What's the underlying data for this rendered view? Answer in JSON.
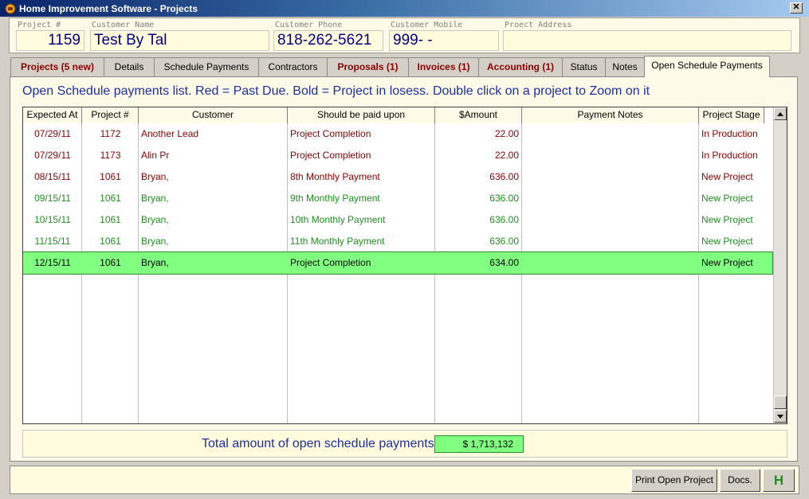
{
  "window": {
    "title": "Home Improvement Software - Projects",
    "close_label": "✕"
  },
  "header": {
    "project_no": {
      "label": "Project #",
      "value": "1159"
    },
    "customer_name": {
      "label": "Customer Name",
      "value": "Test By Tal"
    },
    "customer_phone": {
      "label": "Customer Phone",
      "value": "818-262-5621"
    },
    "customer_mobile": {
      "label": "Customer Mobile",
      "value": "999-  -"
    },
    "project_address": {
      "label": "Proect Address",
      "value": ""
    }
  },
  "tabs": [
    {
      "label": "Projects (5 new)",
      "style": "red"
    },
    {
      "label": "Details",
      "style": "normal"
    },
    {
      "label": "Schedule Payments",
      "style": "normal"
    },
    {
      "label": "Contractors",
      "style": "normal"
    },
    {
      "label": "Proposals (1)",
      "style": "red"
    },
    {
      "label": "Invoices (1)",
      "style": "red"
    },
    {
      "label": "Accounting (1)",
      "style": "red"
    },
    {
      "label": "Status",
      "style": "normal"
    },
    {
      "label": "Notes",
      "style": "normal"
    },
    {
      "label": "Open Schedule Payments",
      "style": "active"
    }
  ],
  "instructions": "Open Schedule payments list. Red = Past Due. Bold = Project in losess. Double click on a project to Zoom on it",
  "table": {
    "columns": [
      "Expected At",
      "Project #",
      "Customer",
      "Should be paid upon",
      "$Amount",
      "Payment Notes",
      "Project Stage"
    ],
    "rows": [
      {
        "expected": "07/29/11",
        "project": "1172",
        "customer": "Another Lead",
        "paid_upon": "Project Completion",
        "amount": "22.00",
        "notes": "",
        "stage": "In Production",
        "status": "past-due"
      },
      {
        "expected": "07/29/11",
        "project": "1173",
        "customer": "Alin Pr",
        "paid_upon": "Project Completion",
        "amount": "22.00",
        "notes": "",
        "stage": "In Production",
        "status": "past-due"
      },
      {
        "expected": "08/15/11",
        "project": "1061",
        "customer": "Bryan,",
        "paid_upon": "8th Monthly Payment",
        "amount": "636.00",
        "notes": "",
        "stage": "New Project",
        "status": "past-due"
      },
      {
        "expected": "09/15/11",
        "project": "1061",
        "customer": "Bryan,",
        "paid_upon": "9th Monthly Payment",
        "amount": "636.00",
        "notes": "",
        "stage": "New Project",
        "status": "open"
      },
      {
        "expected": "10/15/11",
        "project": "1061",
        "customer": "Bryan,",
        "paid_upon": "10th Monthly Payment",
        "amount": "636.00",
        "notes": "",
        "stage": "New Project",
        "status": "open"
      },
      {
        "expected": "11/15/11",
        "project": "1061",
        "customer": "Bryan,",
        "paid_upon": "11th Monthly Payment",
        "amount": "636.00",
        "notes": "",
        "stage": "New Project",
        "status": "open"
      },
      {
        "expected": "12/15/11",
        "project": "1061",
        "customer": "Bryan,",
        "paid_upon": "Project Completion",
        "amount": "634.00",
        "notes": "",
        "stage": "New Project",
        "status": "selected"
      }
    ]
  },
  "total": {
    "label": "Total amount of open schedule payments:",
    "value": "$  1,713,132"
  },
  "buttons": {
    "print_label": "Print Open Project",
    "docs_label": "Docs.",
    "h_label": "H"
  },
  "colors": {
    "past_due": "#8b0000",
    "open": "#1f8f1f",
    "selected_bg": "#80ff80",
    "instruction_text": "#1c2f9e"
  }
}
